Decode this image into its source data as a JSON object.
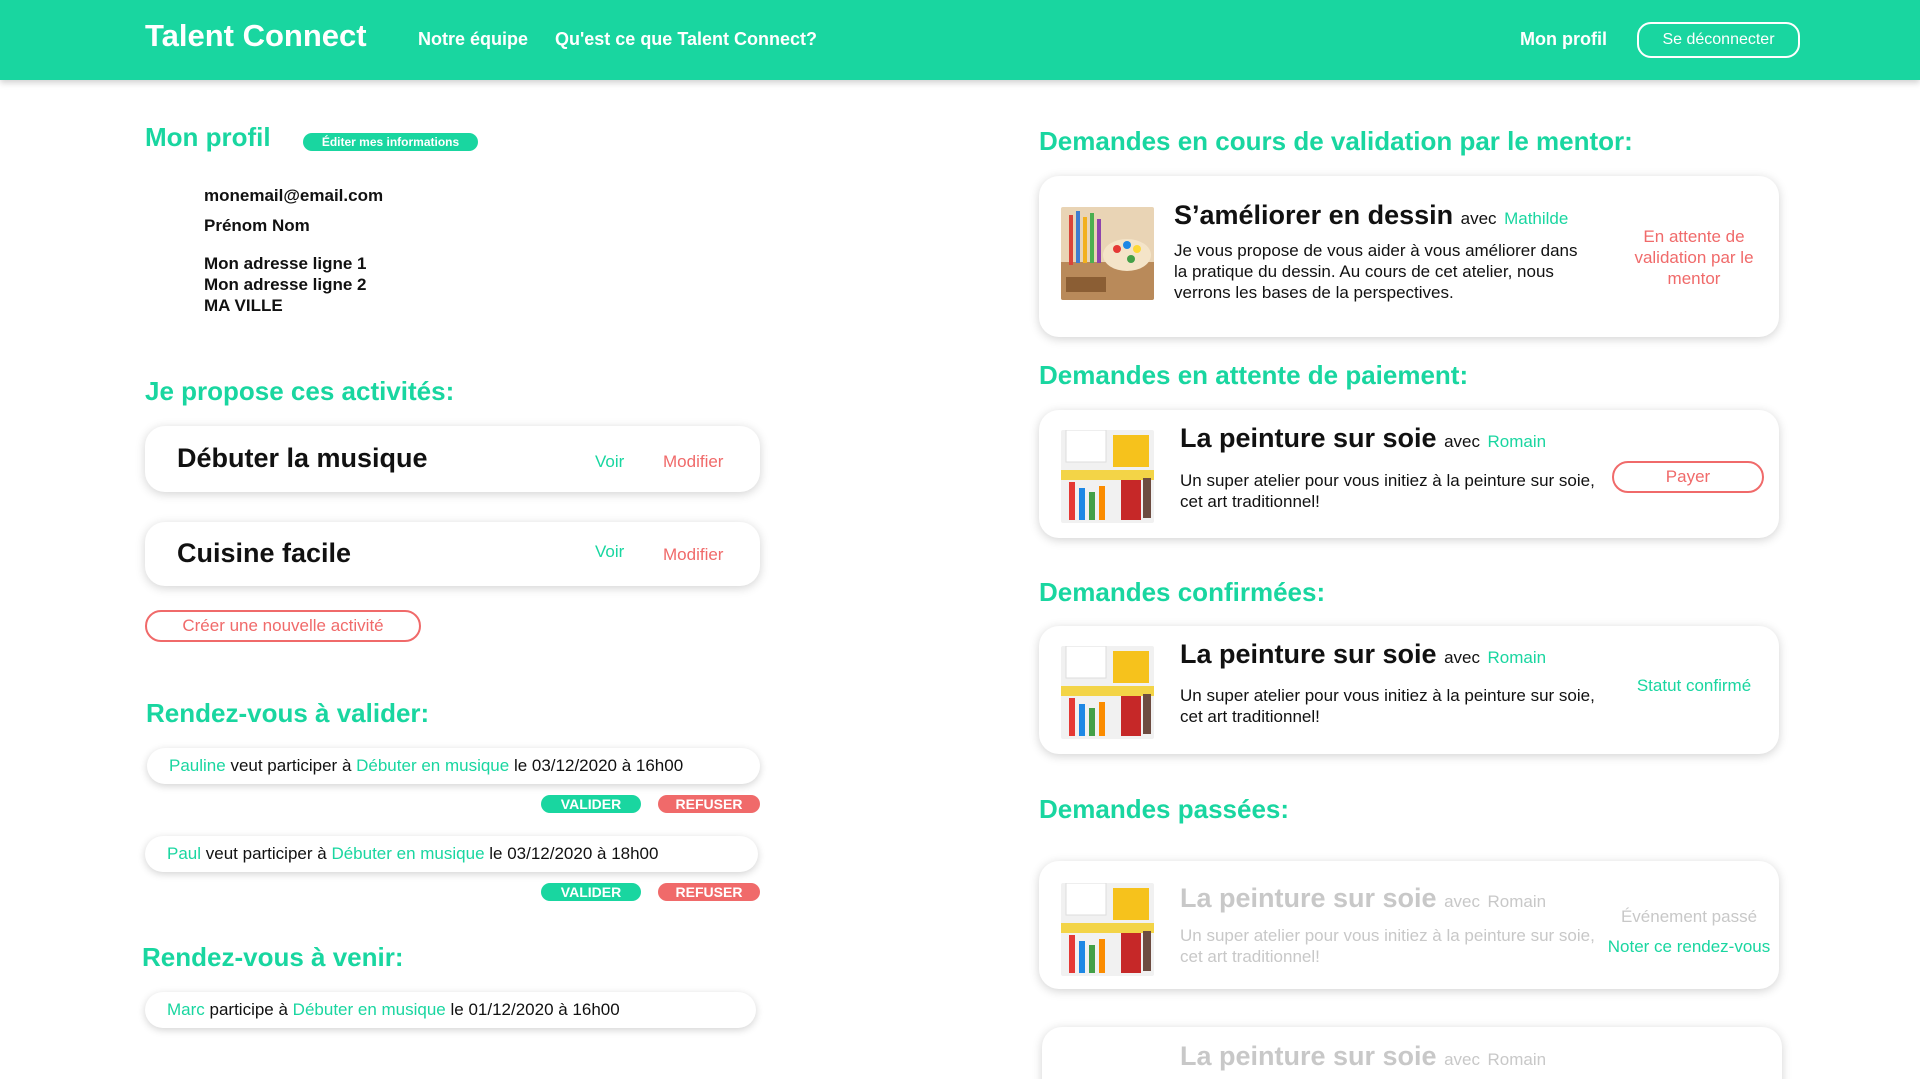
{
  "header": {
    "brand": "Talent Connect",
    "nav": [
      "Notre équipe",
      "Qu'est ce que Talent Connect?"
    ],
    "profile_link": "Mon profil",
    "logout": "Se déconnecter"
  },
  "profile": {
    "title": "Mon profil",
    "edit_button": "Éditer mes informations",
    "email": "monemail@email.com",
    "name": "Prénom Nom",
    "address1": "Mon adresse ligne 1",
    "address2": "Mon adresse ligne 2",
    "city": "MA VILLE"
  },
  "activities": {
    "title": "Je propose ces activités:",
    "items": [
      {
        "name": "Débuter la musique",
        "view": "Voir",
        "edit": "Modifier"
      },
      {
        "name": "Cuisine facile",
        "view": "Voir",
        "edit": "Modifier"
      }
    ],
    "create_button": "Créer une nouvelle activité"
  },
  "to_validate": {
    "title": "Rendez-vous à valider:",
    "items": [
      {
        "person": "Pauline",
        "verb": " veut participer à ",
        "activity": "Débuter en musique",
        "when": " le 03/12/2020 à 16h00",
        "validate": "VALIDER",
        "refuse": "REFUSER"
      },
      {
        "person": "Paul",
        "verb": " veut participer à ",
        "activity": "Débuter en musique",
        "when": " le 03/12/2020 à 18h00",
        "validate": "VALIDER",
        "refuse": "REFUSER"
      }
    ]
  },
  "upcoming": {
    "title": "Rendez-vous à venir:",
    "items": [
      {
        "person": "Marc",
        "verb": " participe à ",
        "activity": "Débuter en musique",
        "when": " le 01/12/2020 à 16h00"
      }
    ]
  },
  "pending_mentor": {
    "title": "Demandes en cours de validation par le mentor:",
    "card": {
      "title": "S’améliorer en dessin",
      "avec": "avec",
      "mentor": "Mathilde",
      "description": "Je vous propose de vous aider à vous améliorer dans la pratique du dessin. Au cours de cet atelier, nous verrons les bases de la perspectives.",
      "status": "En attente de validation par le mentor"
    }
  },
  "pending_payment": {
    "title": "Demandes en attente de paiement:",
    "card": {
      "title": "La peinture sur soie",
      "avec": "avec",
      "mentor": "Romain",
      "description": "Un super atelier pour vous initiez à la peinture sur soie, cet art traditionnel!",
      "pay_button": "Payer"
    }
  },
  "confirmed": {
    "title": "Demandes confirmées:",
    "card": {
      "title": "La peinture sur soie",
      "avec": "avec",
      "mentor": "Romain",
      "description": "Un super atelier pour vous initiez à la peinture sur soie, cet art traditionnel!",
      "status": "Statut confirmé"
    }
  },
  "past": {
    "title": "Demandes passées:",
    "cards": [
      {
        "title": "La peinture sur soie",
        "avec": "avec",
        "mentor": "Romain",
        "description": "Un super atelier pour vous initiez à la peinture sur soie, cet art traditionnel!",
        "status": "Événement passé",
        "rate_link": "Noter ce rendez-vous"
      },
      {
        "title": "La peinture sur soie",
        "avec": "avec",
        "mentor": "Romain"
      }
    ]
  },
  "colors": {
    "accent": "#19d6a0",
    "danger": "#f06a6a",
    "faded": "#c8c8c8"
  }
}
